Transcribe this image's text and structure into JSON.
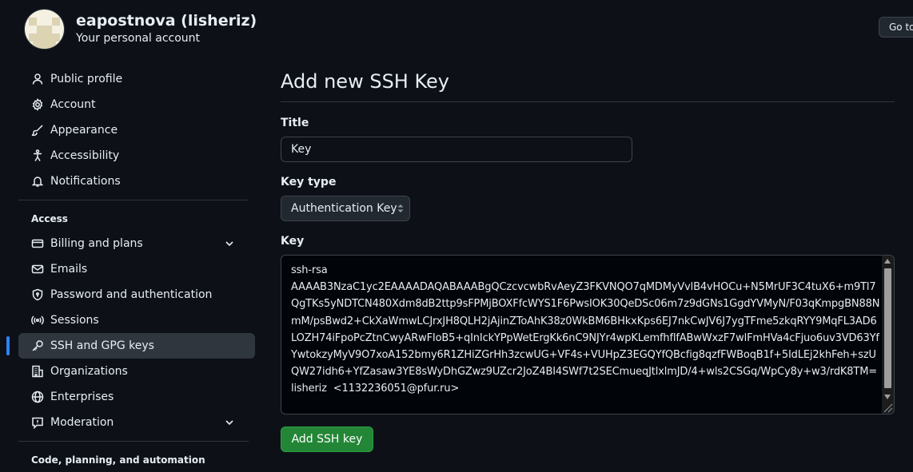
{
  "account": {
    "name": "eapostnova (lisheriz)",
    "subtitle": "Your personal account",
    "goto_button": "Go to your personal profile"
  },
  "sidebar": {
    "items": [
      {
        "label": "Public profile",
        "icon": "person-icon"
      },
      {
        "label": "Account",
        "icon": "gear-icon"
      },
      {
        "label": "Appearance",
        "icon": "paintbrush-icon"
      },
      {
        "label": "Accessibility",
        "icon": "accessibility-icon"
      },
      {
        "label": "Notifications",
        "icon": "bell-icon"
      }
    ],
    "access_title": "Access",
    "access_items": [
      {
        "label": "Billing and plans",
        "icon": "credit-card-icon",
        "expandable": true
      },
      {
        "label": "Emails",
        "icon": "mail-icon"
      },
      {
        "label": "Password and authentication",
        "icon": "shield-lock-icon"
      },
      {
        "label": "Sessions",
        "icon": "broadcast-icon"
      },
      {
        "label": "SSH and GPG keys",
        "icon": "key-icon",
        "active": true
      },
      {
        "label": "Organizations",
        "icon": "organization-icon"
      },
      {
        "label": "Enterprises",
        "icon": "globe-icon"
      },
      {
        "label": "Moderation",
        "icon": "report-icon",
        "expandable": true
      }
    ],
    "code_title": "Code, planning, and automation"
  },
  "main": {
    "title": "Add new SSH Key",
    "title_label": "Title",
    "title_value": "Key",
    "key_type_label": "Key type",
    "key_type_value": "Authentication Key",
    "key_label": "Key",
    "key_value": "ssh-rsa\nAAAAB3NzaC1yc2EAAAADAQABAAABgQCzcvcwbRvAeyZ3FKVNQO7qMDMyVvlB4vHOCu+N5MrUF3C4tuX6+m9Tl7QgTKs5yNDTCN480Xdm8dB2ttp9sFPMjBOXFfcWYS1F6PwsIOK30QeDSc06m7z9dGNs1GgdYVMyN/F03qKmpgBN88NmM/psBwd2+CkXaWmwLCJrxJH8QLH2jAjinZToAhK38z0WkBM6BHkxKps6EJ7nkCwJV6J7ygTFme5zkqRYY9MqFL3AD6LOZH74iFpoPcZtnCwyARwFIoB5+qInIckYPpWetErgKk6nC9NJYr4wpKLemfhflfABwWxzF7wlFmHVa4cFjuo6uv3VD63YfYwtokzyMyV9O7xoA152bmy6R1ZHiZGrHh3zcwUG+VF4s+VUHpZ3EGQYfQBcfig8qzfFWBoqB1f+5IdLEj2khFeh+szUQW27idh6+YfZasaw3YE8sWyDhGZwz9UZcr2JoZ4BI4SWf7t2SECmueqJtlxlmJD/4+wls2CSGq/WpCy8y+w3/rdK8TM= lisheriz  <1132236051@pfur.ru>",
    "submit_label": "Add SSH key"
  },
  "colors": {
    "background": "#0d1117",
    "primary_button": "#238636",
    "active_indicator": "#2f81f7"
  }
}
